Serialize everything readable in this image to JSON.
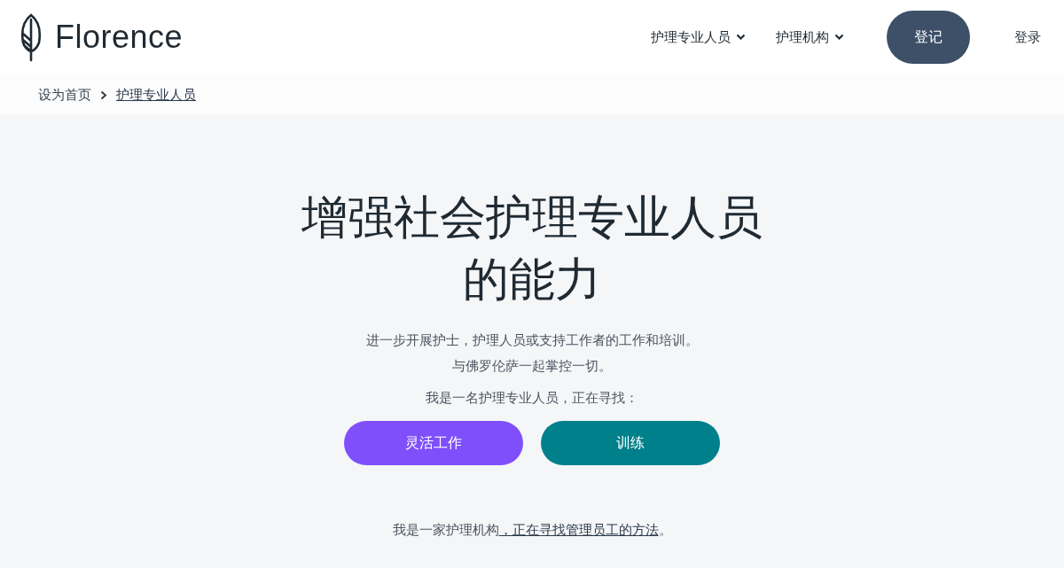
{
  "header": {
    "logo": "Florence",
    "nav": [
      {
        "label": "护理专业人员",
        "dropdown": true
      },
      {
        "label": "护理机构",
        "dropdown": true
      }
    ],
    "signup": "登记",
    "login": "登录"
  },
  "breadcrumb": [
    {
      "label": "设为首页",
      "current": false
    },
    {
      "label": "护理专业人员",
      "current": true
    }
  ],
  "hero": {
    "title_lines": [
      "增强社会护理专业人员",
      "的能力"
    ],
    "intro_lines": [
      "进一步开展护士，护理人员或支持工作者的工作和培训。",
      "与佛罗伦萨一起掌控一切。"
    ],
    "prompt": "我是一名护理专业人员，正在寻找：",
    "buttons": [
      {
        "label": "灵活工作",
        "color": "#7f4ffc"
      },
      {
        "label": "训练",
        "color": "#00808a"
      }
    ],
    "org_text": "我是一家护理机构",
    "org_link": "，正在寻找管理员工的方法",
    "org_end": "。"
  }
}
